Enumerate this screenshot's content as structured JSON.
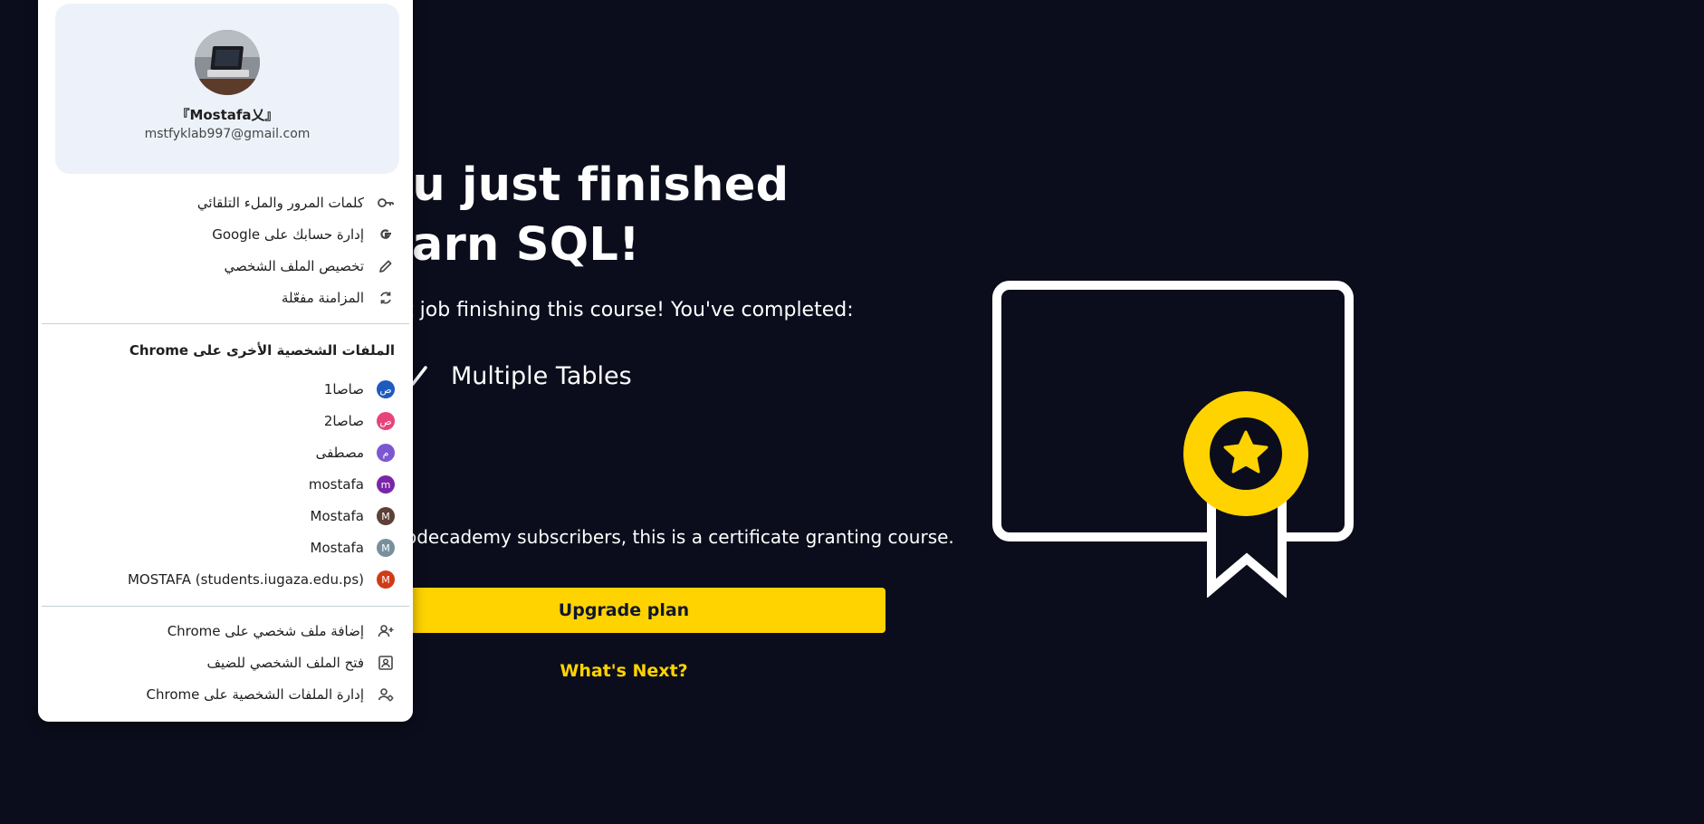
{
  "background": {
    "hero_title_line1": "ou just finished",
    "hero_title_line2": "earn SQL!",
    "hero_subtitle": "t job finishing this course! You've completed:",
    "completed_item": "Multiple Tables",
    "subscriber_note": "odecademy subscribers, this is a certificate granting course.",
    "upgrade_button": "Upgrade plan",
    "whats_next_link": "What's Next?",
    "colors": {
      "background": "#0b0d1c",
      "accent": "#ffd300",
      "text": "#ffffff"
    },
    "certificate_icon": "certificate-icon"
  },
  "profile_menu": {
    "name": "『Mostafa乂』",
    "email": "mstfyklab997@gmail.com",
    "account_actions": [
      {
        "label": "كلمات المرور والملء التلقائي",
        "icon": "key-icon"
      },
      {
        "label": "إدارة حسابك على Google",
        "icon": "google-icon"
      },
      {
        "label": "تخصيص الملف الشخصي",
        "icon": "pencil-icon"
      },
      {
        "label": "المزامنة مفعّلة",
        "icon": "sync-icon"
      }
    ],
    "other_profiles_heading": "الملفات الشخصية الأخرى على Chrome",
    "other_profiles": [
      {
        "label": "صاصا1",
        "badge": "ص",
        "color": "#1e5bbd"
      },
      {
        "label": "صاصا2",
        "badge": "ص",
        "color": "#e8437a"
      },
      {
        "label": "مصطفى",
        "badge": "م",
        "color": "#7b57d1"
      },
      {
        "label": "mostafa",
        "badge": "m",
        "color": "#7a25a8"
      },
      {
        "label": "Mostafa",
        "badge": "M",
        "color": "#5d4037"
      },
      {
        "label": "Mostafa",
        "badge": "M",
        "color": "#78909c"
      },
      {
        "label": "MOSTAFA (students.iugaza.edu.ps)",
        "badge": "M",
        "color": "#d03a16"
      }
    ],
    "footer_actions": [
      {
        "label": "إضافة ملف شخصي على Chrome",
        "icon": "add-person-icon"
      },
      {
        "label": "فتح الملف الشخصي للضيف",
        "icon": "guest-profile-icon"
      },
      {
        "label": "إدارة الملفات الشخصية على Chrome",
        "icon": "manage-profiles-icon"
      }
    ]
  }
}
